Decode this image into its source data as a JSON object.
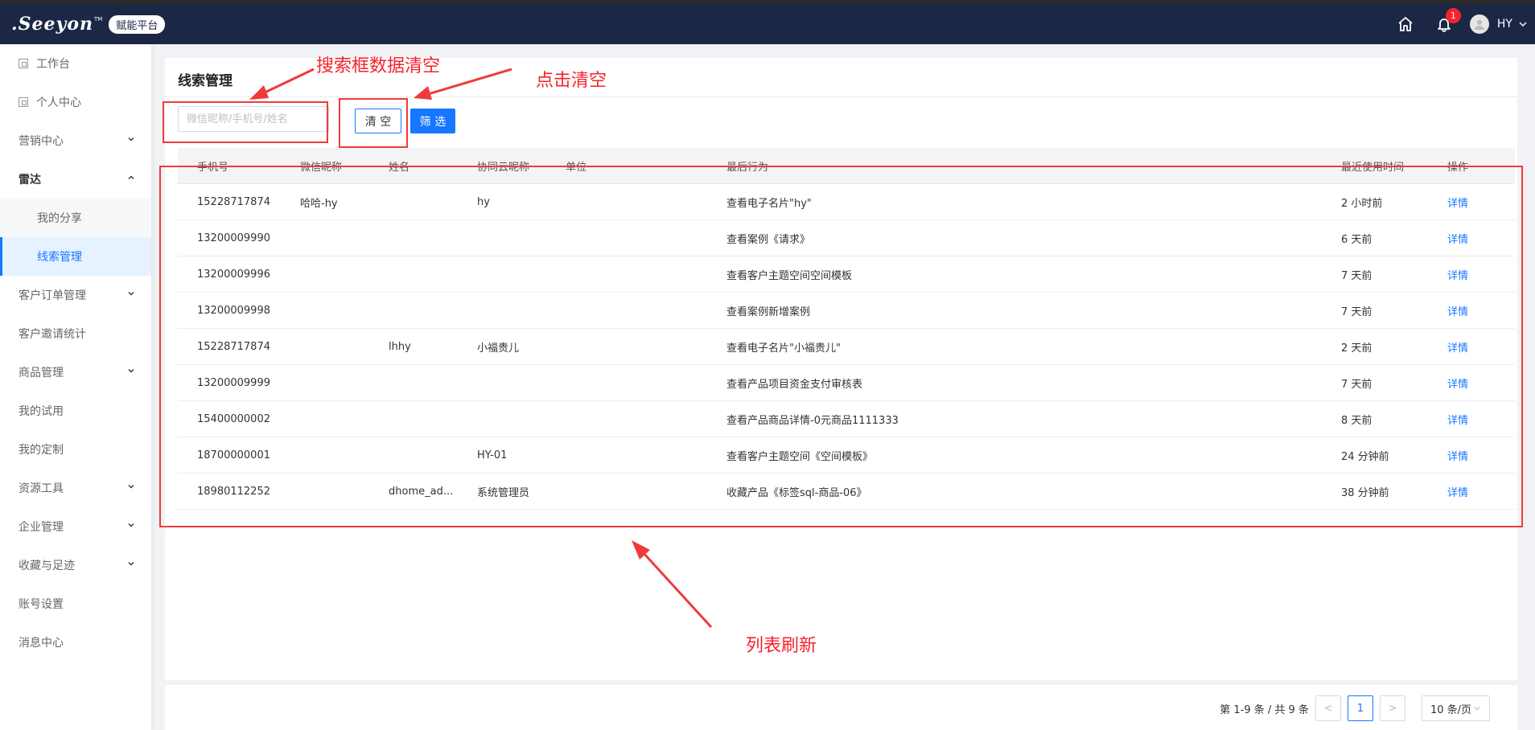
{
  "header": {
    "logo_text": ".Seeyon",
    "logo_tm": "TM",
    "platform_badge": "赋能平台",
    "notification_count": "1",
    "user_name": "HY",
    "icons": [
      "home-icon",
      "bell-icon",
      "user-avatar",
      "chevron-down-icon"
    ]
  },
  "sidebar": {
    "items": [
      {
        "label": "工作台"
      },
      {
        "label": "个人中心"
      },
      {
        "label": "营销中心"
      },
      {
        "label": "雷达"
      },
      {
        "label": "我的分享"
      },
      {
        "label": "线索管理"
      },
      {
        "label": "客户订单管理"
      },
      {
        "label": "客户邀请统计"
      },
      {
        "label": "商品管理"
      },
      {
        "label": "我的试用"
      },
      {
        "label": "我的定制"
      },
      {
        "label": "资源工具"
      },
      {
        "label": "企业管理"
      },
      {
        "label": "收藏与足迹"
      },
      {
        "label": "账号设置"
      },
      {
        "label": "消息中心"
      }
    ]
  },
  "page": {
    "title": "线索管理",
    "search_placeholder": "微信昵称/手机号/姓名",
    "clear_label": "清 空",
    "filter_label": "筛 选"
  },
  "table": {
    "columns": [
      "手机号",
      "微信昵称",
      "姓名",
      "协同云昵称",
      "单位",
      "最后行为",
      "最近使用时间",
      "操作"
    ],
    "rows": [
      [
        "15228717874",
        "哈哈-hy",
        "",
        "hy",
        "",
        "查看电子名片\"hy\"",
        "2 小时前",
        "详情"
      ],
      [
        "13200009990",
        "",
        "",
        "",
        "",
        "查看案例《请求》",
        "6 天前",
        "详情"
      ],
      [
        "13200009996",
        "",
        "",
        "",
        "",
        "查看客户主题空间空间模板",
        "7 天前",
        "详情"
      ],
      [
        "13200009998",
        "",
        "",
        "",
        "",
        "查看案例新增案例",
        "7 天前",
        "详情"
      ],
      [
        "15228717874",
        "",
        "lhhy",
        "小福贵儿",
        "",
        "查看电子名片\"小福贵儿\"",
        "2 天前",
        "详情"
      ],
      [
        "13200009999",
        "",
        "",
        "",
        "",
        "查看产品项目资金支付审核表",
        "7 天前",
        "详情"
      ],
      [
        "15400000002",
        "",
        "",
        "",
        "",
        "查看产品商品详情-0元商品1111333",
        "8 天前",
        "详情"
      ],
      [
        "18700000001",
        "",
        "",
        "HY-01",
        "",
        "查看客户主题空间《空间模板》",
        "24 分钟前",
        "详情"
      ],
      [
        "18980112252",
        "",
        "dhome_ad...",
        "系统管理员",
        "",
        "收藏产品《标签sql-商品-06》",
        "38 分钟前",
        "详情"
      ]
    ]
  },
  "pagination": {
    "summary": "第 1-9 条 / 共 9 条",
    "prev": "<",
    "current": "1",
    "next": ">",
    "page_size": "10 条/页"
  },
  "annotations": {
    "search_clear": "搜索框数据清空",
    "click_clear": "点击清空",
    "list_refresh": "列表刷新",
    "color": "#f5222d"
  }
}
